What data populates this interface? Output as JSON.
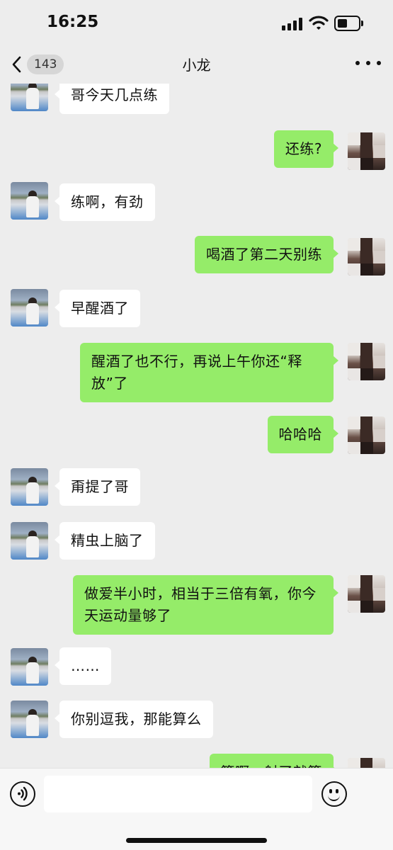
{
  "status_bar": {
    "time": "16:25"
  },
  "nav": {
    "unread_count": "143",
    "title": "小龙"
  },
  "messages": [
    {
      "from": "friend",
      "text": "哥今天几点练"
    },
    {
      "from": "self",
      "text": "还练?"
    },
    {
      "from": "friend",
      "text": "练啊，有劲"
    },
    {
      "from": "self",
      "text": "喝酒了第二天别练"
    },
    {
      "from": "friend",
      "text": "早醒酒了"
    },
    {
      "from": "self",
      "text": "醒酒了也不行，再说上午你还“释放”了"
    },
    {
      "from": "self",
      "text": "哈哈哈"
    },
    {
      "from": "friend",
      "text": "甭提了哥"
    },
    {
      "from": "friend",
      "text": "精虫上脑了"
    },
    {
      "from": "self",
      "text": "做爱半小时，相当于三倍有氧，你今天运动量够了"
    },
    {
      "from": "friend",
      "text": "……"
    },
    {
      "from": "friend",
      "text": "你别逗我，那能算么"
    },
    {
      "from": "self",
      "text": "算啊，射了就算"
    }
  ],
  "input_bar": {
    "placeholder": ""
  },
  "icons": {
    "back": "chevron-left-icon",
    "more": "more-dots-icon",
    "voice": "voice-icon",
    "emoji": "emoji-icon"
  },
  "colors": {
    "background": "#ededed",
    "incoming_bubble": "#ffffff",
    "outgoing_bubble": "#95ec69",
    "badge": "#d6d6d6"
  }
}
